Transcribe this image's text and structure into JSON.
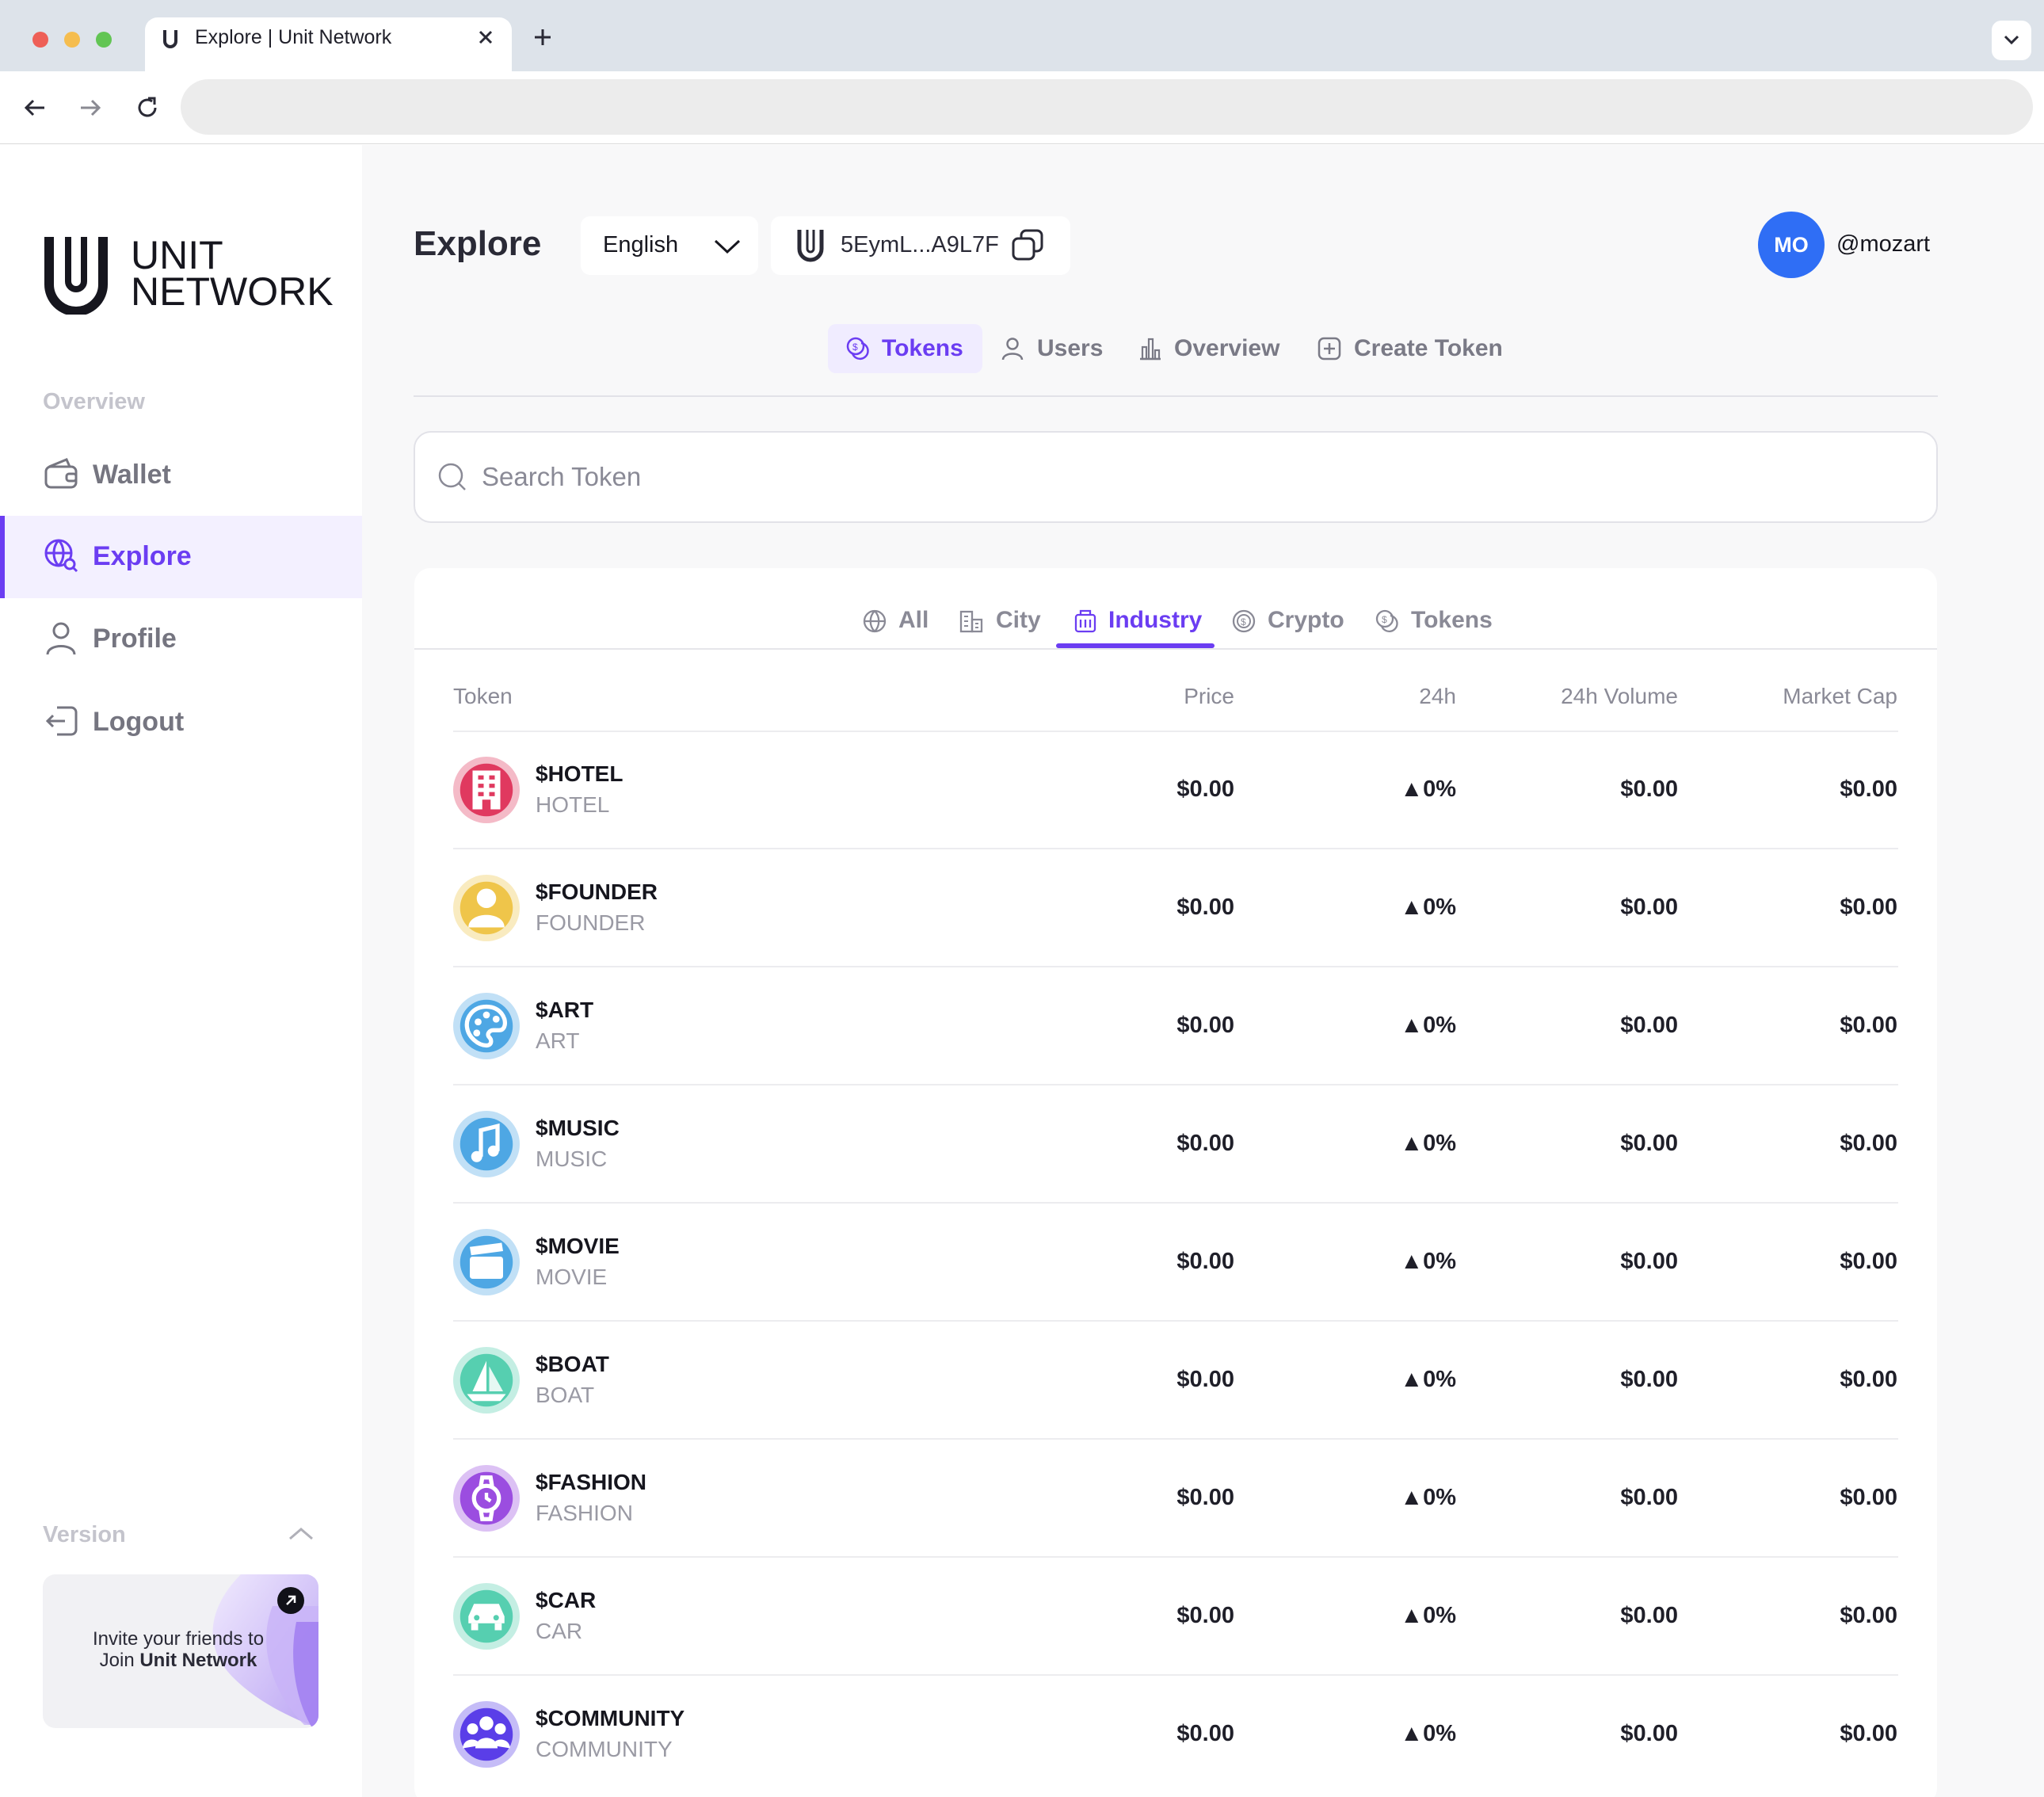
{
  "browser": {
    "tab_title": "Explore | Unit Network",
    "tab_icon": "unit-logo-icon",
    "colors": {
      "close_dot": "#ee5f57",
      "minimize_dot": "#f5bd4f",
      "maximize_dot": "#62c554"
    }
  },
  "sidebar": {
    "logo": {
      "line1": "UNIT",
      "line2": "NETWORK"
    },
    "section_label": "Overview",
    "items": [
      {
        "label": "Wallet",
        "icon": "wallet-icon",
        "active": false
      },
      {
        "label": "Explore",
        "icon": "globe-search-icon",
        "active": true
      },
      {
        "label": "Profile",
        "icon": "user-icon",
        "active": false
      },
      {
        "label": "Logout",
        "icon": "logout-icon",
        "active": false
      }
    ],
    "version_label": "Version",
    "invite": {
      "text": "Invite your friends to",
      "join_prefix": "Join ",
      "brand": "Unit Network"
    }
  },
  "header": {
    "title": "Explore",
    "language": "English",
    "wallet_address": "5EymL...A9L7F",
    "avatar_initials": "MO",
    "username": "@mozart"
  },
  "primary_tabs": [
    {
      "label": "Tokens",
      "icon": "coin-icon",
      "active": true
    },
    {
      "label": "Users",
      "icon": "user-icon",
      "active": false
    },
    {
      "label": "Overview",
      "icon": "bar-chart-icon",
      "active": false
    },
    {
      "label": "Create Token",
      "icon": "plus-square-icon",
      "active": false
    }
  ],
  "search": {
    "placeholder": "Search Token"
  },
  "category_tabs": [
    {
      "label": "All",
      "icon": "globe-icon",
      "active": false
    },
    {
      "label": "City",
      "icon": "city-icon",
      "active": false
    },
    {
      "label": "Industry",
      "icon": "building-icon",
      "active": true
    },
    {
      "label": "Crypto",
      "icon": "crypto-icon",
      "active": false
    },
    {
      "label": "Tokens",
      "icon": "coin-icon",
      "active": false
    }
  ],
  "table": {
    "columns": [
      "Token",
      "Price",
      "24h",
      "24h Volume",
      "Market Cap"
    ],
    "rows": [
      {
        "symbol": "$HOTEL",
        "name": "HOTEL",
        "price": "$0.00",
        "change": "0%",
        "volume": "$0.00",
        "market_cap": "$0.00",
        "icon": "hotel-icon",
        "color": "#e0395f"
      },
      {
        "symbol": "$FOUNDER",
        "name": "FOUNDER",
        "price": "$0.00",
        "change": "0%",
        "volume": "$0.00",
        "market_cap": "$0.00",
        "icon": "founder-icon",
        "color": "#efc54a"
      },
      {
        "symbol": "$ART",
        "name": "ART",
        "price": "$0.00",
        "change": "0%",
        "volume": "$0.00",
        "market_cap": "$0.00",
        "icon": "palette-icon",
        "color": "#4ea7e4"
      },
      {
        "symbol": "$MUSIC",
        "name": "MUSIC",
        "price": "$0.00",
        "change": "0%",
        "volume": "$0.00",
        "market_cap": "$0.00",
        "icon": "music-note-icon",
        "color": "#4ea7e4"
      },
      {
        "symbol": "$MOVIE",
        "name": "MOVIE",
        "price": "$0.00",
        "change": "0%",
        "volume": "$0.00",
        "market_cap": "$0.00",
        "icon": "clapperboard-icon",
        "color": "#4ea7e4"
      },
      {
        "symbol": "$BOAT",
        "name": "BOAT",
        "price": "$0.00",
        "change": "0%",
        "volume": "$0.00",
        "market_cap": "$0.00",
        "icon": "sailboat-icon",
        "color": "#56cfb0"
      },
      {
        "symbol": "$FASHION",
        "name": "FASHION",
        "price": "$0.00",
        "change": "0%",
        "volume": "$0.00",
        "market_cap": "$0.00",
        "icon": "watch-icon",
        "color": "#9b4de0"
      },
      {
        "symbol": "$CAR",
        "name": "CAR",
        "price": "$0.00",
        "change": "0%",
        "volume": "$0.00",
        "market_cap": "$0.00",
        "icon": "car-icon",
        "color": "#56cfb0"
      },
      {
        "symbol": "$COMMUNITY",
        "name": "COMMUNITY",
        "price": "$0.00",
        "change": "0%",
        "volume": "$0.00",
        "market_cap": "$0.00",
        "icon": "people-icon",
        "color": "#5a3ee8"
      }
    ]
  },
  "colors": {
    "accent": "#6b3df2",
    "avatar": "#2f6ef5",
    "active_bg": "#f3f0ff"
  }
}
